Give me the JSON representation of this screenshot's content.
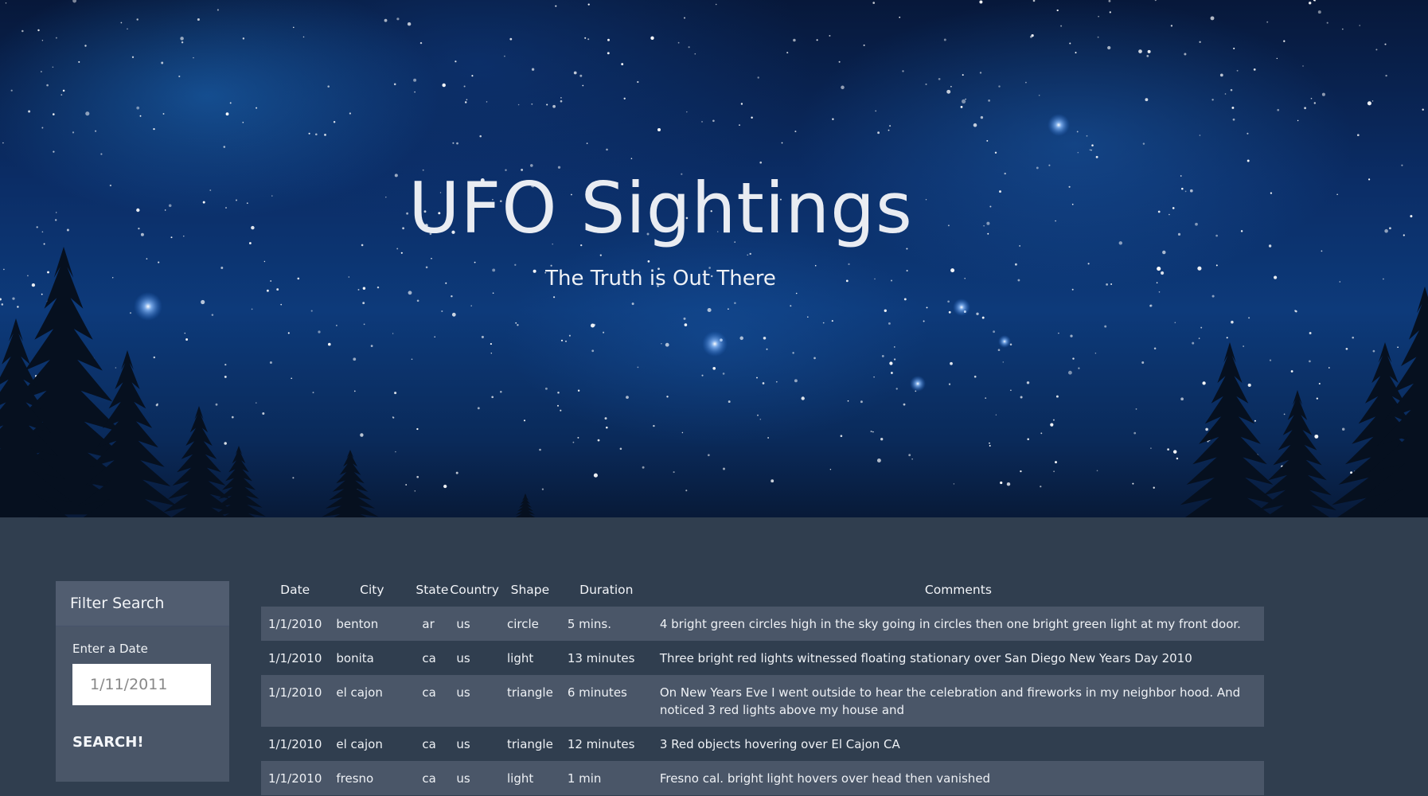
{
  "hero": {
    "title": "UFO Sightings",
    "subtitle": "The Truth is Out There"
  },
  "filter": {
    "header": "Filter Search",
    "date_label": "Enter a Date",
    "date_placeholder": "1/11/2011",
    "search_label": "SEARCH!"
  },
  "table": {
    "headers": [
      "Date",
      "City",
      "State",
      "Country",
      "Shape",
      "Duration",
      "Comments"
    ],
    "rows": [
      [
        "1/1/2010",
        "benton",
        "ar",
        "us",
        "circle",
        "5 mins.",
        "4 bright green circles high in the sky going in circles then one bright green light at my front door."
      ],
      [
        "1/1/2010",
        "bonita",
        "ca",
        "us",
        "light",
        "13 minutes",
        "Three bright red lights witnessed floating stationary over San Diego New Years Day 2010"
      ],
      [
        "1/1/2010",
        "el cajon",
        "ca",
        "us",
        "triangle",
        "6 minutes",
        "On New Years Eve I went outside to hear the celebration and fireworks in my neighbor hood. And noticed 3 red lights above my house and"
      ],
      [
        "1/1/2010",
        "el cajon",
        "ca",
        "us",
        "triangle",
        "12 minutes",
        "3 Red objects hovering over El Cajon CA"
      ],
      [
        "1/1/2010",
        "fresno",
        "ca",
        "us",
        "light",
        "1 min",
        "Fresno cal. bright light hovers over head then vanished"
      ]
    ]
  },
  "colors": {
    "page_bg": "#303e4f",
    "panel_bg": "#4a5668",
    "row_stripe": "#4a5668",
    "sky_deep": "#0b2d66"
  }
}
